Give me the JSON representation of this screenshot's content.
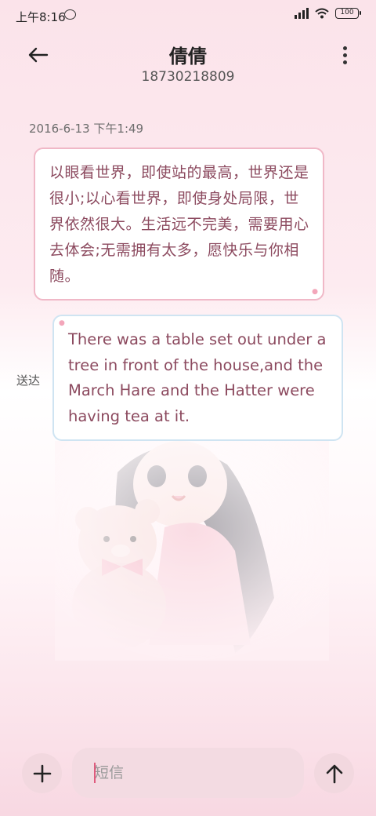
{
  "status_bar": {
    "time": "上午8:16",
    "battery": "100"
  },
  "header": {
    "contact_name": "倩倩",
    "contact_number": "18730218809"
  },
  "conversation": {
    "timestamp": "2016-6-13 下午1:49",
    "incoming_message": "以眼看世界，即使站的最高，世界还是很小;以心看世界，即使身处局限，世界依然很大。生活远不完美，需要用心去体会;无需拥有太多，愿快乐与你相随。",
    "outgoing_message": "There was a table set out under a tree in front of the house,and the March Hare and the Hatter were having tea at it.",
    "outgoing_status": "送达"
  },
  "composer": {
    "placeholder": "短信",
    "value": ""
  },
  "icons": {
    "back": "back-arrow-icon",
    "more": "more-vertical-icon",
    "add": "plus-icon",
    "send": "send-arrow-icon"
  },
  "colors": {
    "accent": "#e05b7e",
    "incoming_border": "#f0b8c7",
    "outgoing_border": "#cfe4f2",
    "message_text": "#8c4a5f"
  }
}
